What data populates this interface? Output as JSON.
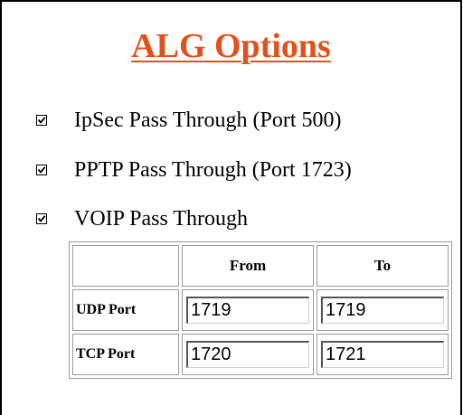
{
  "title": "ALG Options",
  "options": [
    {
      "label": "IpSec Pass Through (Port 500)",
      "checked": true
    },
    {
      "label": "PPTP Pass Through (Port 1723)",
      "checked": true
    },
    {
      "label": "VOIP Pass Through",
      "checked": true
    }
  ],
  "voip_table": {
    "headers": [
      "",
      "From",
      "To"
    ],
    "rows": [
      {
        "label": "UDP Port",
        "from": "1719",
        "to": "1719"
      },
      {
        "label": "TCP Port",
        "from": "1720",
        "to": "1721"
      }
    ]
  }
}
